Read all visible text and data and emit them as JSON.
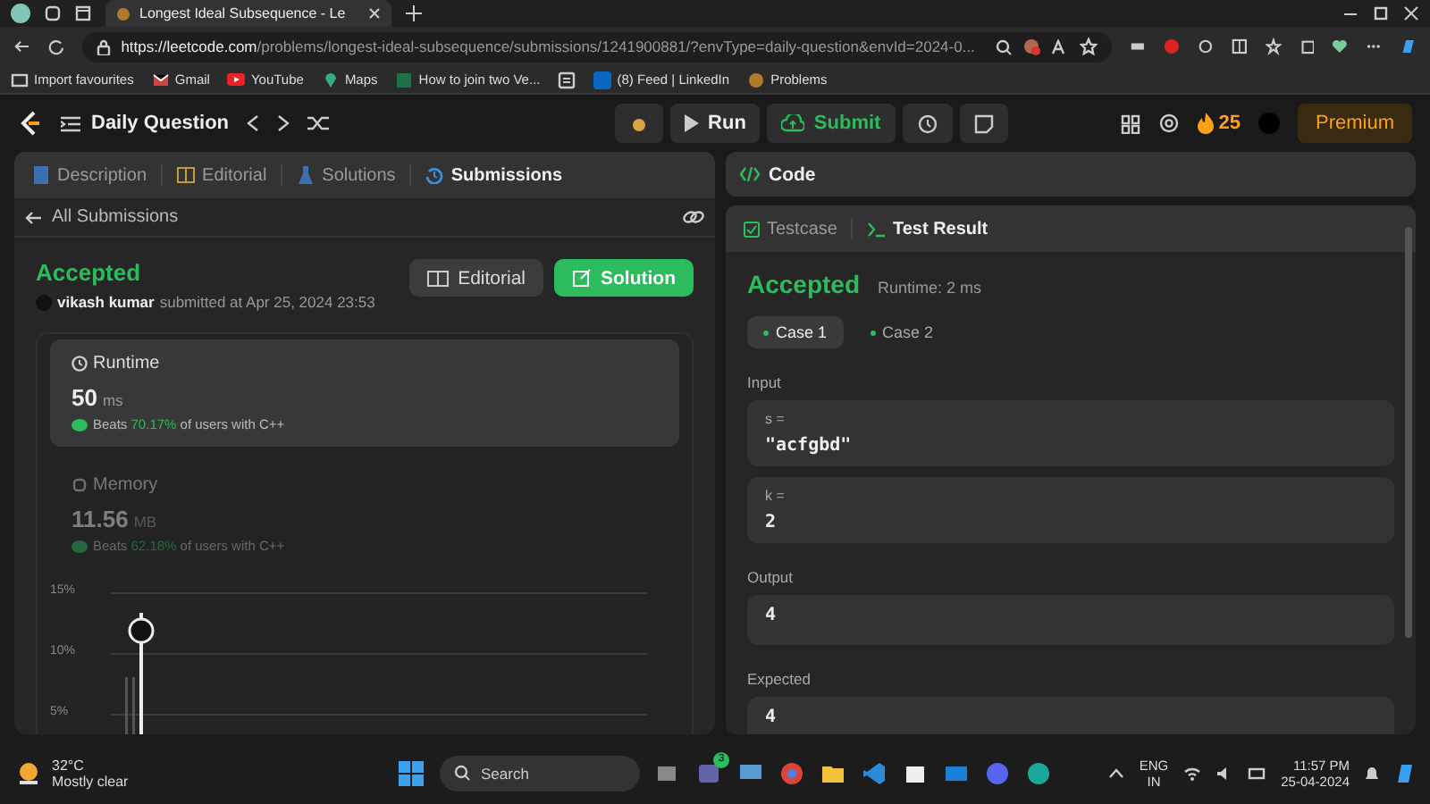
{
  "browser": {
    "tab_title": "Longest Ideal Subsequence - Le",
    "url_host": "https://leetcode.com",
    "url_path": "/problems/longest-ideal-subsequence/submissions/1241900881/?envType=daily-question&envId=2024-0...",
    "bookmarks": [
      {
        "label": "Import favourites",
        "kind": "folder"
      },
      {
        "label": "Gmail",
        "kind": "mail"
      },
      {
        "label": "YouTube",
        "kind": "video"
      },
      {
        "label": "Maps",
        "kind": "pin"
      },
      {
        "label": "How to join two Ve...",
        "kind": "sheet"
      },
      {
        "kind": "doc"
      },
      {
        "label": "(8) Feed | LinkedIn",
        "kind": "in"
      },
      {
        "label": "Problems",
        "kind": "site"
      }
    ]
  },
  "header": {
    "title": "Daily Question",
    "run": "Run",
    "submit": "Submit",
    "streak": "25",
    "premium": "Premium"
  },
  "left": {
    "tabs": [
      {
        "label": "Description",
        "selected": false
      },
      {
        "label": "Editorial",
        "selected": false
      },
      {
        "label": "Solutions",
        "selected": false
      },
      {
        "label": "Submissions",
        "selected": true
      }
    ],
    "back": "All Submissions",
    "status": "Accepted",
    "user": "vikash kumar",
    "submitted": "submitted at Apr 25, 2024 23:53",
    "buttons": [
      {
        "label": "Editorial",
        "kind": "plain"
      },
      {
        "label": "Solution",
        "kind": "primary"
      }
    ],
    "metrics": [
      {
        "title": "Runtime",
        "value": "50",
        "unit": "ms",
        "beats": "Beats",
        "percent": "70.17%",
        "suffix": "of users with C++",
        "selected": true
      },
      {
        "title": "Memory",
        "value": "11.56",
        "unit": "MB",
        "beats": "Beats",
        "percent": "62.18%",
        "suffix": "of users with C++",
        "selected": false
      }
    ],
    "chart_axis": [
      "15%",
      "10%",
      "5%"
    ]
  },
  "right": {
    "code_title": "Code",
    "tabs": [
      {
        "label": "Testcase",
        "selected": false
      },
      {
        "label": "Test Result",
        "selected": true
      }
    ],
    "status": "Accepted",
    "runtime": "Runtime: 2 ms",
    "cases": [
      {
        "label": "Case 1",
        "selected": true
      },
      {
        "label": "Case 2",
        "selected": false
      }
    ],
    "sections": [
      {
        "label": "Input",
        "boxes": [
          {
            "name": "s =",
            "value": "\"acfgbd\""
          },
          {
            "name": "k =",
            "value": "2"
          }
        ]
      },
      {
        "label": "Output",
        "boxes": [
          {
            "value": "4"
          }
        ]
      },
      {
        "label": "Expected",
        "boxes": [
          {
            "value": "4"
          }
        ]
      }
    ]
  },
  "taskbar": {
    "temp": "32°C",
    "weather": "Mostly clear",
    "search": "Search",
    "badge": "3",
    "lang": "ENG",
    "region": "IN",
    "time": "11:57 PM",
    "date": "25-04-2024"
  }
}
